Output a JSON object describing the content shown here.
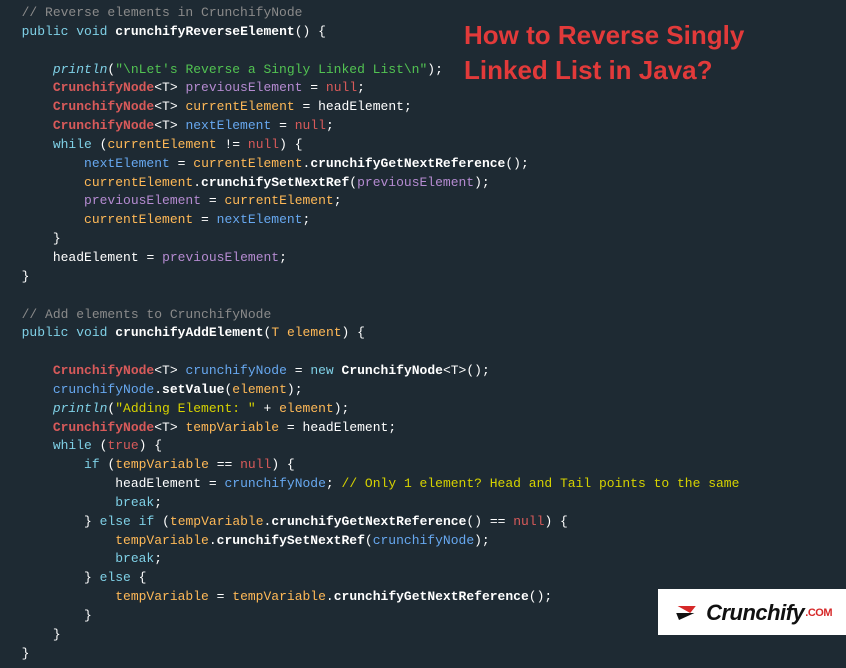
{
  "title_overlay": "How to Reverse Singly Linked List in Java?",
  "logo": {
    "brand": "Crunchify",
    "suffix": ".COM"
  },
  "code": {
    "l01": "// Reverse elements in CrunchifyNode",
    "l02_public": "public",
    "l02_void": "void",
    "l02_name": "crunchifyReverseElement",
    "l03_println": "println",
    "l03_string": "\"\\nLet's Reverse a Singly Linked List\\n\"",
    "l04_type": "CrunchifyNode",
    "l04_generic": "<T>",
    "l04_var": "previousElement",
    "l04_null": "null",
    "l05_var": "currentElement",
    "l05_rhs": "headElement",
    "l06_var": "nextElement",
    "l06_null": "null",
    "l07_while": "while",
    "l07_cond_lhs": "currentElement",
    "l07_op": "!=",
    "l07_null": "null",
    "l08_lhs": "nextElement",
    "l08_rhs": "currentElement",
    "l08_method": "crunchifyGetNextReference",
    "l09_lhs": "currentElement",
    "l09_method": "crunchifySetNextRef",
    "l09_arg": "previousElement",
    "l10_lhs": "previousElement",
    "l10_rhs": "currentElement",
    "l11_lhs": "currentElement",
    "l11_rhs": "nextElement",
    "l13_lhs": "headElement",
    "l13_rhs": "previousElement",
    "l15": "// Add elements to CrunchifyNode",
    "l16_name": "crunchifyAddElement",
    "l16_argtype": "T",
    "l16_arg": "element",
    "l17_var": "crunchifyNode",
    "l17_new": "new",
    "l17_ctor": "CrunchifyNode",
    "l18_lhs": "crunchifyNode",
    "l18_method": "setValue",
    "l18_arg": "element",
    "l19_println": "println",
    "l19_string": "\"Adding Element: \"",
    "l19_plus": "+",
    "l19_rhs": "element",
    "l20_var": "tempVariable",
    "l20_rhs": "headElement",
    "l21_while": "while",
    "l21_true": "true",
    "l22_if": "if",
    "l22_lhs": "tempVariable",
    "l22_op": "==",
    "l22_null": "null",
    "l23_lhs": "headElement",
    "l23_rhs": "crunchifyNode",
    "l23_comment": "// Only 1 element? Head and Tail points to the same",
    "l24_break": "break",
    "l25_else": "else",
    "l25_if": "if",
    "l25_lhs": "tempVariable",
    "l25_method": "crunchifyGetNextReference",
    "l25_op": "==",
    "l25_null": "null",
    "l26_lhs": "tempVariable",
    "l26_method": "crunchifySetNextRef",
    "l26_arg": "crunchifyNode",
    "l27_break": "break",
    "l28_else": "else",
    "l29_lhs": "tempVariable",
    "l29_rhs": "tempVariable",
    "l29_method": "crunchifyGetNextReference"
  }
}
